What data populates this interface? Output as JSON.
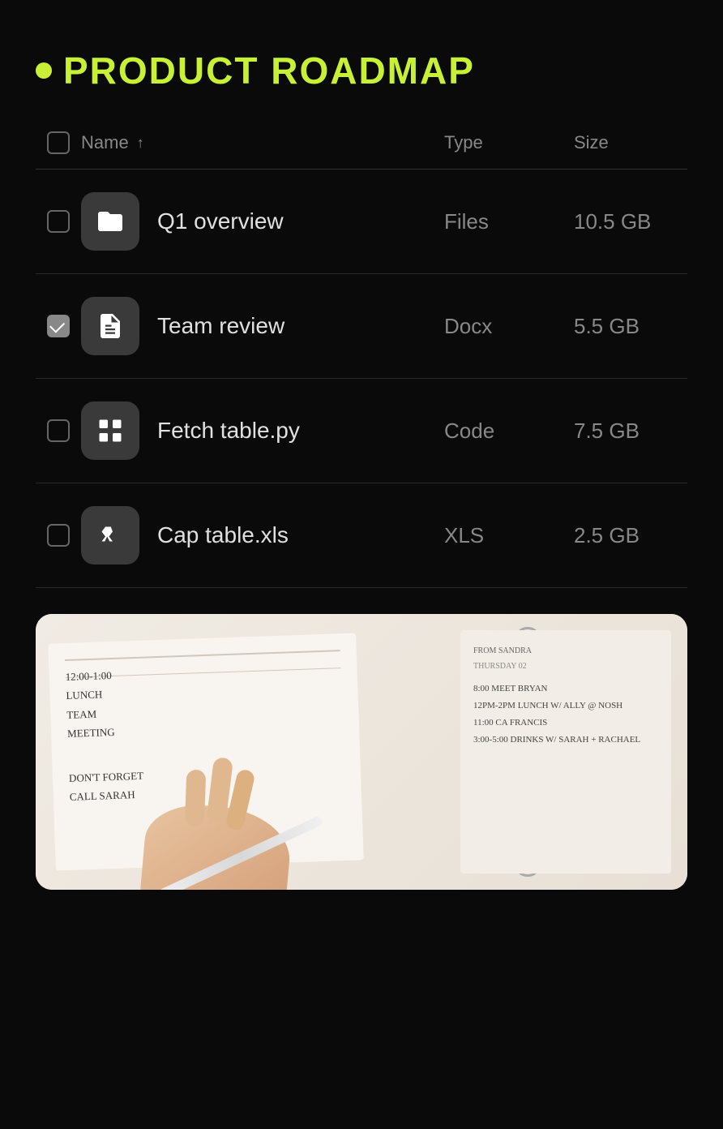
{
  "page": {
    "title": "PRODUCT ROADMAP",
    "title_dot_color": "#c8f135",
    "background_color": "#0a0a0a"
  },
  "table": {
    "header": {
      "checkbox_label": "select-all",
      "name_label": "Name",
      "sort_indicator": "↑",
      "type_label": "Type",
      "size_label": "Size"
    },
    "rows": [
      {
        "id": "row-1",
        "checked": false,
        "icon_type": "folder",
        "name": "Q1 overview",
        "type": "Files",
        "size": "10.5 GB"
      },
      {
        "id": "row-2",
        "checked": true,
        "icon_type": "document",
        "name": "Team review",
        "type": "Docx",
        "size": "5.5 GB"
      },
      {
        "id": "row-3",
        "checked": false,
        "icon_type": "code",
        "name": "Fetch table.py",
        "type": "Code",
        "size": "7.5 GB"
      },
      {
        "id": "row-4",
        "checked": false,
        "icon_type": "spreadsheet",
        "name": "Cap table.xls",
        "type": "XLS",
        "size": "2.5 GB"
      }
    ]
  },
  "image": {
    "alt": "Notebook with handwritten notes"
  },
  "notebook_notes": {
    "left_lines": [
      "12:00-1:00",
      "LUNCH",
      "TEAM",
      "MEETING",
      "DON'T FORGET",
      "CALL SARAH"
    ],
    "right_lines": [
      "FROM SANDRA",
      "THURSDAY 02",
      "8:00 MEET BRYAN",
      "12PM-2PM LUNCH W/ ALLY @ NOSH",
      "11:00 CA FRANCIS",
      "3:00-5:00 DRINKS W/ SARAH + RACHAEL"
    ]
  }
}
